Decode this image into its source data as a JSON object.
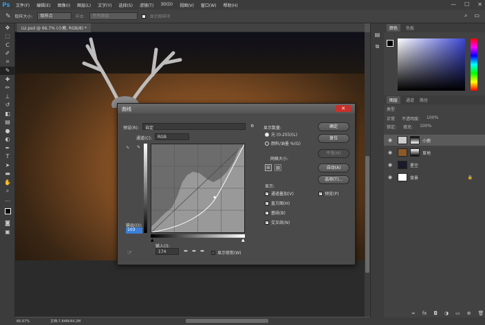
{
  "app": {
    "logo": "Ps"
  },
  "menu": [
    "文件(F)",
    "编辑(E)",
    "图像(I)",
    "图层(L)",
    "文字(Y)",
    "选择(S)",
    "滤镜(T)",
    "3D(D)",
    "视图(V)",
    "窗口(W)",
    "帮助(H)"
  ],
  "options": {
    "sample_size_label": "取样大小:",
    "sample_size_value": "取样点",
    "sample_label": "样本:",
    "sample_value": "所有图层",
    "show_ring": "显示取样环"
  },
  "document": {
    "tab_title": "LU.psd @ 66.7% (小鹿, RGB/8) *"
  },
  "status": {
    "zoom": "66.67%",
    "doc_info": "文档:7.84M/44.2M"
  },
  "right_panel": {
    "color_tabs": [
      "颜色",
      "色板"
    ],
    "layer_tabs": [
      "图层",
      "通道",
      "路径"
    ],
    "kind_label": "类型",
    "opacity_label": "不透明度:",
    "opacity_value": "100%",
    "lock_label": "锁定:",
    "fill_label": "填充:",
    "fill_value": "100%",
    "mode_value": "正常",
    "layers": [
      {
        "name": "小鹿"
      },
      {
        "name": "草地"
      },
      {
        "name": "星空"
      },
      {
        "name": "背景"
      }
    ]
  },
  "curves": {
    "title": "曲线",
    "preset_label": "预设(R):",
    "preset_value": "自定",
    "channel_label": "通道(C):",
    "channel_value": "RGB",
    "output_label": "输出(O):",
    "output_value": "103",
    "input_label": "输入(I):",
    "input_value": "174",
    "show_clipping": "显示修剪(W)",
    "display_amount_title": "显示数量:",
    "light_option": "光 (0-255)(L)",
    "pigment_option": "颜料/油墨 %(G)",
    "grid_size_title": "网格大小:",
    "show_title": "显示:",
    "show_options": [
      "通道叠加(V)",
      "直方图(H)",
      "基线(B)",
      "交叉线(N)"
    ],
    "buttons": {
      "ok": "确定",
      "reset": "复位",
      "smooth": "平滑(M)",
      "auto": "自动(A)",
      "options": "选项(T)...",
      "preview": "预览(P)"
    }
  },
  "colors": {
    "accent": "#31a8ff",
    "close": "#c9302c",
    "panel": "#424242",
    "canvas_bg": "#535353"
  }
}
